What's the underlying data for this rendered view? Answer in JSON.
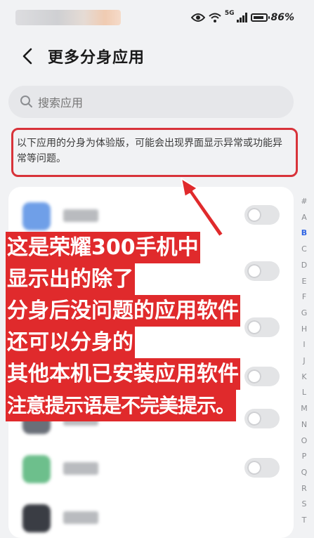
{
  "status_bar": {
    "battery_text": "86%",
    "network_label": "5G"
  },
  "header": {
    "title": "更多分身应用"
  },
  "search": {
    "placeholder": "搜索应用"
  },
  "notice": {
    "text": "以下应用的分身为体验版，可能会出现界面显示异常或功能异常等问题。"
  },
  "app_list": {
    "items": [
      {
        "icon_color": "#6f9fe8",
        "enabled": false
      },
      {
        "icon_color": "#5b8dd9",
        "enabled": false
      },
      {
        "icon_color": "#444a55",
        "enabled": false
      },
      {
        "icon_color": "#8ccfa0",
        "enabled": false
      },
      {
        "icon_color": "#6a6f78",
        "enabled": false
      },
      {
        "icon_color": "#9aa0a8",
        "enabled": false
      },
      {
        "icon_color": "#6dbf8c",
        "enabled": false
      },
      {
        "icon_color": "#3a3d44",
        "enabled": false
      }
    ]
  },
  "index_bar": {
    "letters": [
      "#",
      "A",
      "B",
      "C",
      "D",
      "E",
      "F",
      "G",
      "H",
      "I",
      "J",
      "K",
      "L",
      "M",
      "N",
      "O",
      "P",
      "Q",
      "R",
      "S",
      "T"
    ],
    "active": "B"
  },
  "annotation": {
    "lines": [
      "这是荣耀300手机中",
      "显示出的除了",
      "分身后没问题的应用软件",
      "还可以分身的",
      "其他本机已安装应用软件",
      "注意提示语是不完美提示。"
    ],
    "color": "#e02a2c"
  }
}
